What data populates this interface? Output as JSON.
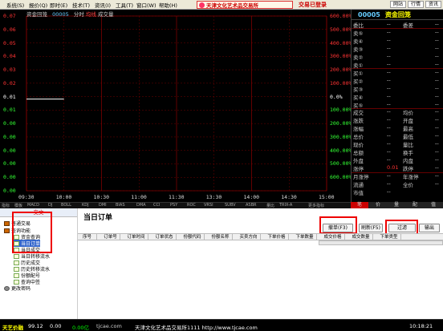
{
  "menu": [
    "系统(S)",
    "报价(Q)",
    "即时(E)",
    "技术(T)",
    "资讯(I)",
    "工具(T)",
    "窗口(W)",
    "帮助(H)"
  ],
  "logo_text": "天津文化艺术品交易所",
  "login_status": "交易已登录",
  "top_buttons": [
    "网站",
    "行情",
    "资讯"
  ],
  "chart": {
    "title": "资金回笼",
    "code": "00005",
    "label_mode": "分时",
    "label_avg": "均线",
    "label_vol": "成交量"
  },
  "chart_data": {
    "type": "line",
    "title": "资金回笼",
    "x_ticks": [
      "09:30",
      "10:00",
      "10:30",
      "11:00",
      "11:30",
      "13:30",
      "14:00",
      "14:30",
      "15:00"
    ],
    "y_ticks_left": [
      "0.07",
      "0.06",
      "0.05",
      "0.04",
      "0.03",
      "0.02",
      "0.01",
      "0.01",
      "0.00",
      "0.00",
      "0.00",
      "0.00",
      "0.00",
      "0.00"
    ],
    "y_ticks_right": [
      "600.00%",
      "500.00%",
      "400.00%",
      "300.00%",
      "200.00%",
      "100.00%",
      "0.0%",
      "100.00%",
      "200.00%",
      "300.00%",
      "400.00%",
      "500.00%",
      "600.00%"
    ],
    "series": [
      {
        "x": [
          "09:30",
          "10:00"
        ],
        "values": [
          0.01,
          0.01
        ]
      }
    ],
    "grid": true
  },
  "quote": {
    "code": "00005",
    "name": "资金回笼",
    "rows": [
      {
        "label": "委比",
        "value": "--",
        "label2": "委差",
        "value2": "--"
      },
      {
        "label": "卖⑤",
        "value": "--",
        "label2": "",
        "value2": "--"
      },
      {
        "label": "卖④",
        "value": "--",
        "label2": "",
        "value2": "--"
      },
      {
        "label": "卖③",
        "value": "--",
        "label2": "",
        "value2": "--"
      },
      {
        "label": "卖②",
        "value": "--",
        "label2": "",
        "value2": "--"
      },
      {
        "label": "卖①",
        "value": "--",
        "label2": "",
        "value2": "--"
      },
      {
        "label": "买①",
        "value": "--",
        "label2": "",
        "value2": "--"
      },
      {
        "label": "买②",
        "value": "--",
        "label2": "",
        "value2": "--"
      },
      {
        "label": "买③",
        "value": "--",
        "label2": "",
        "value2": "--"
      },
      {
        "label": "买④",
        "value": "--",
        "label2": "",
        "value2": "--"
      },
      {
        "label": "买⑤",
        "value": "--",
        "label2": "",
        "value2": "--"
      },
      {
        "label": "成交",
        "value": "--",
        "label2": "均价",
        "value2": "--"
      },
      {
        "label": "涨跌",
        "value": "--",
        "label2": "开盘",
        "value2": "--"
      },
      {
        "label": "涨幅",
        "value": "--",
        "label2": "最高",
        "value2": "--"
      },
      {
        "label": "总价",
        "value": "--",
        "label2": "最低",
        "value2": "--"
      },
      {
        "label": "现价",
        "value": "--",
        "label2": "量比",
        "value2": "--"
      },
      {
        "label": "总额",
        "value": "--",
        "label2": "换手",
        "value2": "--"
      },
      {
        "label": "外盘",
        "value": "--",
        "label2": "内盘",
        "value2": "--"
      },
      {
        "label": "涨停",
        "value": "0.01",
        "label2": "跌停",
        "value2": "--"
      },
      {
        "label": "月涨停",
        "value": "--",
        "label2": "年涨停",
        "value2": "--"
      },
      {
        "label": "流通",
        "value": "--",
        "label2": "全价",
        "value2": "--"
      },
      {
        "label": "市值",
        "value": "--",
        "label2": "",
        "value2": ""
      }
    ]
  },
  "indicators": [
    "指标",
    "模板",
    "MACD",
    "DJ",
    "BOLL",
    "KDJ",
    "DMI",
    "BIAS",
    "DMA",
    "CCI",
    "PSY",
    "ROC",
    "VRSI",
    "SUBV",
    "ASBR",
    "量比",
    "TRIX-A",
    "更多指标"
  ],
  "quote_tabs": [
    "笔",
    "价",
    "量",
    "配",
    "值"
  ],
  "nav": {
    "header": "交文",
    "items": [
      "普通交易",
      "查询功能",
      "资金查询",
      "当日订单",
      "当日成交",
      "当日转移流水",
      "历史成交",
      "历史转移流水",
      "份额配号",
      "查询中签",
      "更改密码"
    ]
  },
  "main": {
    "title": "当日订单",
    "buttons": {
      "cancel": "撤单(F3)",
      "refresh": "刷新(F5)",
      "filter": "过滤",
      "export": "输出"
    },
    "columns": [
      "序号",
      "订单号",
      "订单时间",
      "订单状态",
      "份额代码",
      "份额名称",
      "买卖方向",
      "下单价格",
      "下单数量",
      "成交价格",
      "成交数量",
      "下单类型"
    ]
  },
  "statusbar": {
    "name": "天艺价融",
    "index": "99.12",
    "change": "0.00",
    "amount": "0.00亿",
    "site1": "tjcae.com",
    "exchange": "天津文化艺术品交易所1111 http://www.tjcae.com",
    "time": "10:18:21"
  },
  "colors": {
    "up": "#ff3333",
    "flat": "#ffffff",
    "down": "#33ff33",
    "highlight": "#e00000"
  }
}
